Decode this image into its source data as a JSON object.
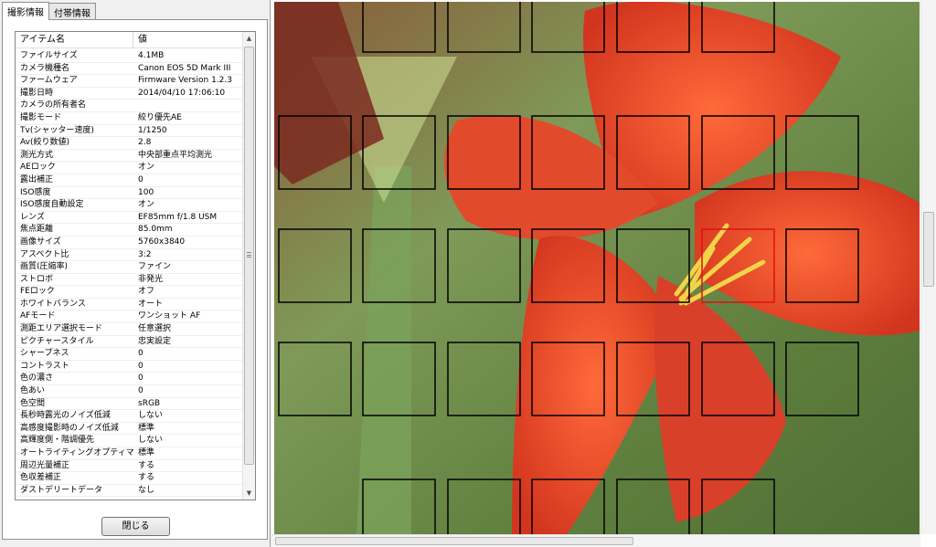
{
  "tabs": [
    {
      "label": "撮影情報",
      "active": true
    },
    {
      "label": "付帯情報",
      "active": false
    }
  ],
  "table": {
    "headers": {
      "name": "アイテム名",
      "value": "値"
    },
    "rows": [
      {
        "name": "ファイルサイズ",
        "value": "4.1MB"
      },
      {
        "name": "カメラ機種名",
        "value": "Canon EOS 5D Mark III"
      },
      {
        "name": "ファームウェア",
        "value": "Firmware Version 1.2.3"
      },
      {
        "name": "撮影日時",
        "value": "2014/04/10 17:06:10"
      },
      {
        "name": "カメラの所有者名",
        "value": ""
      },
      {
        "name": "撮影モード",
        "value": "絞り優先AE"
      },
      {
        "name": "Tv(シャッター速度)",
        "value": "1/1250"
      },
      {
        "name": "Av(絞り数値)",
        "value": "2.8"
      },
      {
        "name": "測光方式",
        "value": "中央部重点平均測光"
      },
      {
        "name": "AEロック",
        "value": "オン"
      },
      {
        "name": "露出補正",
        "value": "0"
      },
      {
        "name": "ISO感度",
        "value": "100"
      },
      {
        "name": "ISO感度自動設定",
        "value": "オン"
      },
      {
        "name": "レンズ",
        "value": "EF85mm f/1.8 USM"
      },
      {
        "name": "焦点距離",
        "value": "85.0mm"
      },
      {
        "name": "画像サイズ",
        "value": "5760x3840"
      },
      {
        "name": "アスペクト比",
        "value": "3:2"
      },
      {
        "name": "画質(圧縮率)",
        "value": "ファイン"
      },
      {
        "name": "ストロボ",
        "value": "非発光"
      },
      {
        "name": "FEロック",
        "value": "オフ"
      },
      {
        "name": "ホワイトバランス",
        "value": "オート"
      },
      {
        "name": "AFモード",
        "value": "ワンショット AF"
      },
      {
        "name": "測距エリア選択モード",
        "value": "任意選択"
      },
      {
        "name": "ピクチャースタイル",
        "value": "忠実設定"
      },
      {
        "name": "シャープネス",
        "value": "0"
      },
      {
        "name": "コントラスト",
        "value": "0"
      },
      {
        "name": "色の濃さ",
        "value": "0"
      },
      {
        "name": "色あい",
        "value": "0"
      },
      {
        "name": "色空間",
        "value": "sRGB"
      },
      {
        "name": "長秒時露光のノイズ低減",
        "value": "しない"
      },
      {
        "name": "高感度撮影時のノイズ低減",
        "value": "標準"
      },
      {
        "name": "高輝度側・階調優先",
        "value": "しない"
      },
      {
        "name": "オートライティングオプティマイザ",
        "value": "標準"
      },
      {
        "name": "周辺光量補正",
        "value": "する"
      },
      {
        "name": "色収差補正",
        "value": "する"
      },
      {
        "name": "ダストデリートデータ",
        "value": "なし"
      }
    ]
  },
  "close_button": {
    "label": "閉じる"
  },
  "af_grid": {
    "rows": 5,
    "cols": 7,
    "selected": {
      "row": 2,
      "col": 5
    },
    "frame_color": "#000000",
    "selected_color": "#e01010"
  },
  "colors": {
    "petal": "#e8432a",
    "petal_dark": "#b82a1a",
    "background_green": "#6f8a4a",
    "stamen": "#f2d44a"
  }
}
